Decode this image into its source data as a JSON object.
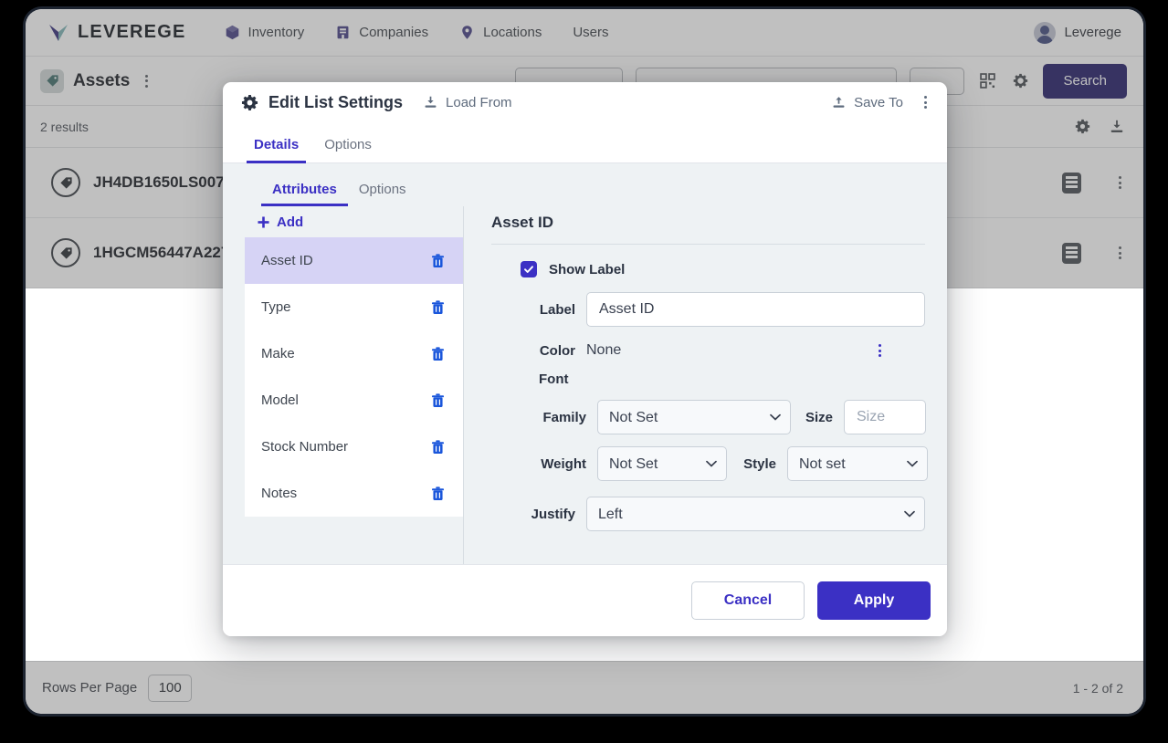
{
  "header": {
    "brand": "LEVEREGE",
    "brand_icon": "leverege-checkmark-logo",
    "nav": [
      {
        "label": "Inventory",
        "icon": "cube-icon"
      },
      {
        "label": "Companies",
        "icon": "building-icon"
      },
      {
        "label": "Locations",
        "icon": "map-pin-icon"
      },
      {
        "label": "Users",
        "icon": ""
      }
    ],
    "user": {
      "name": "Leverege",
      "icon": "avatar-icon"
    }
  },
  "toolbar": {
    "page_title": "Assets",
    "page_icon": "tag-icon",
    "menu_icon": "kebab-menu-icon",
    "qr_icon": "qr-code-icon",
    "gear_icon": "gear-icon",
    "search_label": "Search"
  },
  "results_bar": {
    "count_text": "2 results",
    "gear_icon": "gear-icon",
    "download_icon": "download-icon"
  },
  "rows": [
    {
      "label": "JH4DB1650LS007",
      "icon": "tag-circle-icon",
      "list_icon": "list-icon",
      "menu_icon": "kebab-menu-icon"
    },
    {
      "label": "1HGCM56447A227",
      "icon": "tag-circle-icon",
      "list_icon": "list-icon",
      "menu_icon": "kebab-menu-icon"
    }
  ],
  "footer": {
    "rows_per_page_label": "Rows Per Page",
    "rows_per_page_value": "100",
    "pagination": "1 - 2 of 2"
  },
  "modal": {
    "title": "Edit List Settings",
    "title_icon": "gear-icon",
    "load_from": "Load From",
    "load_from_icon": "download-icon",
    "save_to": "Save To",
    "save_to_icon": "upload-icon",
    "menu_icon": "kebab-menu-icon",
    "tabs": [
      {
        "label": "Details",
        "active": true
      },
      {
        "label": "Options",
        "active": false
      }
    ],
    "inner_tabs": [
      {
        "label": "Attributes",
        "active": true
      },
      {
        "label": "Options",
        "active": false
      }
    ],
    "add_label": "Add",
    "add_icon": "plus-icon",
    "attributes": [
      {
        "label": "Asset ID",
        "selected": true,
        "delete_icon": "trash-icon"
      },
      {
        "label": "Type",
        "selected": false,
        "delete_icon": "trash-icon"
      },
      {
        "label": "Make",
        "selected": false,
        "delete_icon": "trash-icon"
      },
      {
        "label": "Model",
        "selected": false,
        "delete_icon": "trash-icon"
      },
      {
        "label": "Stock Number",
        "selected": false,
        "delete_icon": "trash-icon"
      },
      {
        "label": "Notes",
        "selected": false,
        "delete_icon": "trash-icon"
      }
    ],
    "detail": {
      "title": "Asset ID",
      "show_label_text": "Show Label",
      "show_label_checked": true,
      "label_field_label": "Label",
      "label_field_value": "Asset ID",
      "color_label": "Color",
      "color_value": "None",
      "color_menu_icon": "kebab-menu-icon",
      "font_label": "Font",
      "family_label": "Family",
      "family_value": "Not Set",
      "size_label": "Size",
      "size_value": "",
      "size_placeholder": "Size",
      "weight_label": "Weight",
      "weight_value": "Not Set",
      "style_label": "Style",
      "style_value": "Not set",
      "justify_label": "Justify",
      "justify_value": "Left"
    },
    "cancel_label": "Cancel",
    "apply_label": "Apply"
  },
  "colors": {
    "accent": "#3b30c4",
    "selected_row": "#d6d3f5",
    "panel_bg": "#eef2f4",
    "trash": "#1a56db"
  }
}
